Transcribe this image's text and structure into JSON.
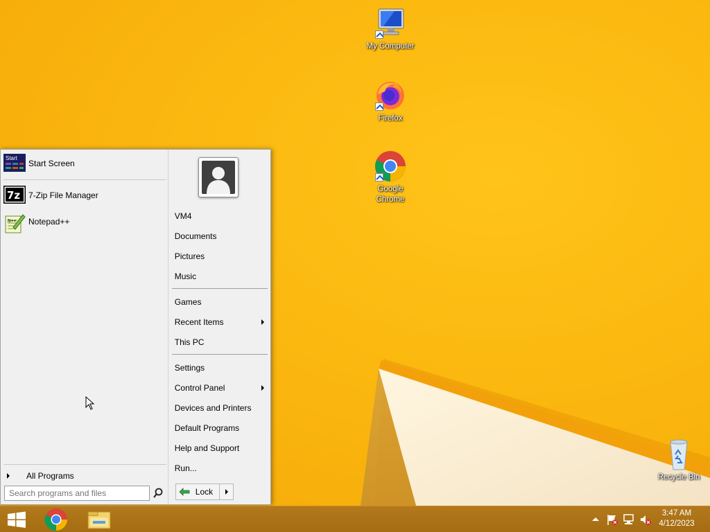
{
  "desktop": {
    "icons": [
      {
        "label": "My Computer",
        "icon": "monitor-icon"
      },
      {
        "label": "Firefox",
        "icon": "firefox-icon"
      },
      {
        "label": "Google Chrome",
        "icon": "chrome-icon"
      },
      {
        "label": "Recycle Bin",
        "icon": "recycle-bin-icon"
      }
    ]
  },
  "start_menu": {
    "left": {
      "items": [
        {
          "label": "Start Screen",
          "icon": "start-screen-icon"
        },
        {
          "label": "7-Zip File Manager",
          "icon": "7zip-icon"
        },
        {
          "label": "Notepad++",
          "icon": "notepadpp-icon"
        }
      ],
      "start_icon_text": "Start",
      "zip_icon_text": "7z",
      "all_programs": "All Programs",
      "search_placeholder": "Search programs and files"
    },
    "right": {
      "user_name": "VM4",
      "group1": [
        "Documents",
        "Pictures",
        "Music"
      ],
      "group2": [
        "Games",
        "Recent Items",
        "This PC"
      ],
      "group3": [
        "Settings",
        "Control Panel",
        "Devices and Printers",
        "Default Programs",
        "Help and Support",
        "Run..."
      ],
      "lock_label": "Lock"
    }
  },
  "taskbar": {
    "time": "3:47 AM",
    "date": "4/12/2023",
    "pinned": [
      "windows-start-icon",
      "chrome-icon",
      "file-explorer-icon"
    ],
    "tray": [
      "show-hidden-icons-arrow",
      "action-center-flag-icon",
      "network-icon",
      "volume-muted-icon"
    ]
  },
  "colors": {
    "wallpaper": "#f8b40c",
    "taskbar": "#a56c12",
    "menu_bg": "#f0f0f0"
  }
}
